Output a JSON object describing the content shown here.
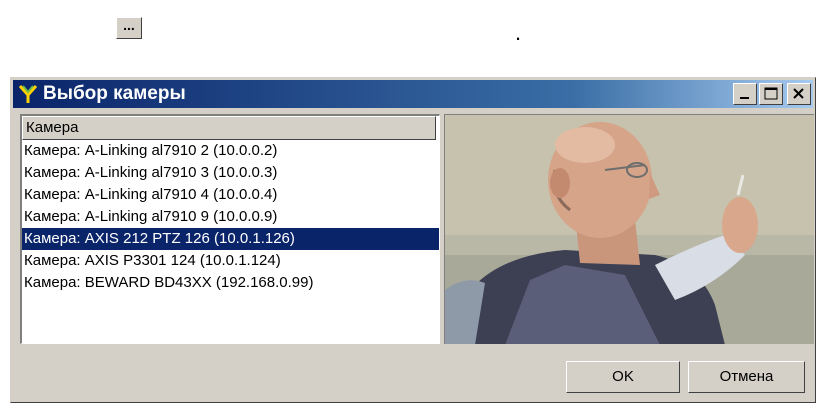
{
  "top": {
    "ellipsis_label": "...",
    "dot": "."
  },
  "dialog": {
    "title": "Выбор камеры",
    "list_header": "Камера",
    "items": [
      {
        "label": "Камера: A-Linking al7910 2 (10.0.0.2)",
        "selected": false
      },
      {
        "label": "Камера: A-Linking al7910 3 (10.0.0.3)",
        "selected": false
      },
      {
        "label": "Камера: A-Linking al7910 4 (10.0.0.4)",
        "selected": false
      },
      {
        "label": "Камера: A-Linking al7910 9 (10.0.0.9)",
        "selected": false
      },
      {
        "label": "Камера: AXIS 212 PTZ 126 (10.0.1.126)",
        "selected": true
      },
      {
        "label": "Камера: AXIS P3301 124 (10.0.1.124)",
        "selected": false
      },
      {
        "label": "Камера: BEWARD BD43XX (192.168.0.99)",
        "selected": false
      }
    ],
    "ok_label": "OK",
    "cancel_label": "Отмена"
  },
  "colors": {
    "titlebar_start": "#0a246a",
    "titlebar_end": "#a6caf0",
    "selection": "#0a246a",
    "face": "#d4d0c8"
  },
  "icons": {
    "title": "camera-app-icon",
    "minimize": "minimize-icon",
    "maximize": "maximize-icon",
    "close": "close-icon"
  }
}
